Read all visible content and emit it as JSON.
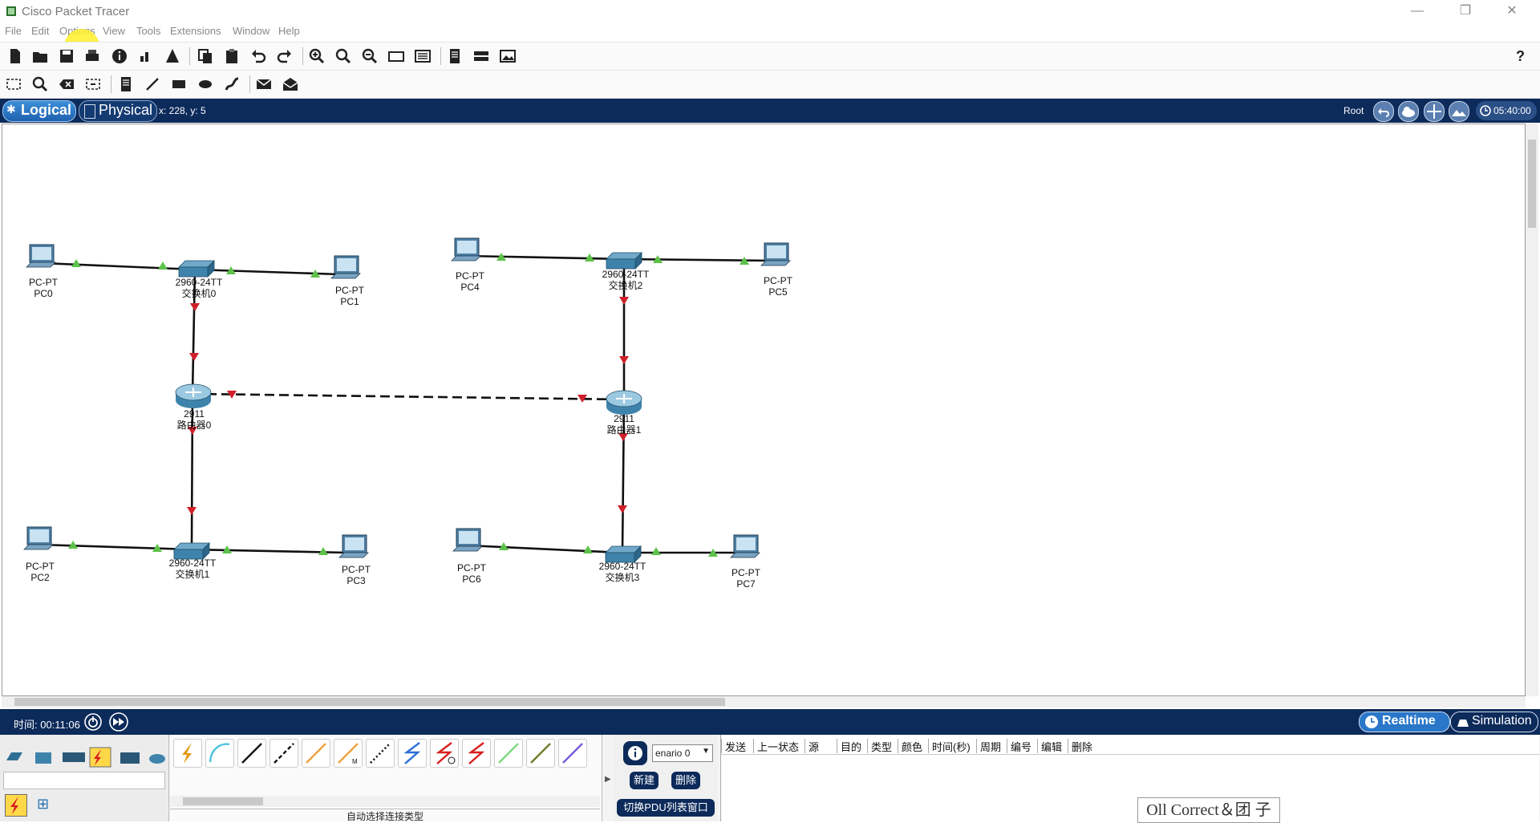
{
  "window": {
    "title": "Cisco Packet Tracer"
  },
  "menu": [
    "File",
    "Edit",
    "Options",
    "View",
    "Tools",
    "Extensions",
    "Window",
    "Help"
  ],
  "help_label": "?",
  "mode_bar": {
    "logical_tab": "Logical",
    "physical_tab": "Physical",
    "coords": "x: 228, y: 5",
    "root": "Root",
    "clock": "05:40:00"
  },
  "devices": [
    {
      "id": "pc0",
      "model": "PC-PT",
      "name": "PC0"
    },
    {
      "id": "sw0",
      "model": "2960-24TT",
      "name": "交换机0"
    },
    {
      "id": "pc1",
      "model": "PC-PT",
      "name": "PC1"
    },
    {
      "id": "pc4",
      "model": "PC-PT",
      "name": "PC4"
    },
    {
      "id": "sw2",
      "model": "2960-24TT",
      "name": "交换机2"
    },
    {
      "id": "pc5",
      "model": "PC-PT",
      "name": "PC5"
    },
    {
      "id": "r0",
      "model": "2911",
      "name": "路由器0"
    },
    {
      "id": "r1",
      "model": "2911",
      "name": "路由器1"
    },
    {
      "id": "pc2",
      "model": "PC-PT",
      "name": "PC2"
    },
    {
      "id": "sw1",
      "model": "2960-24TT",
      "name": "交换机1"
    },
    {
      "id": "pc3",
      "model": "PC-PT",
      "name": "PC3"
    },
    {
      "id": "pc6",
      "model": "PC-PT",
      "name": "PC6"
    },
    {
      "id": "sw3",
      "model": "2960-24TT",
      "name": "交换机3"
    },
    {
      "id": "pc7",
      "model": "PC-PT",
      "name": "PC7"
    }
  ],
  "status_bar": {
    "time": "时间: 00:11:06",
    "realtime": "Realtime",
    "simulation": "Simulation"
  },
  "bottom": {
    "cable_hint": "自动选择连接类型",
    "scenario": "enario 0",
    "new_button": "新建",
    "delete_button": "删除",
    "toggle_pdu": "切换PDU列表窗口",
    "pdu_columns": [
      "发送",
      "上一状态",
      "源",
      "目的",
      "类型",
      "颜色",
      "时间(秒)",
      "周期",
      "编号",
      "编辑",
      "删除"
    ]
  },
  "watermark": "Oll Correct＆团 子",
  "colors": {
    "navy": "#0c2a5a",
    "link_up": "#5cc24a",
    "link_down": "#d0202a",
    "accent_blue": "#1e62b0"
  }
}
